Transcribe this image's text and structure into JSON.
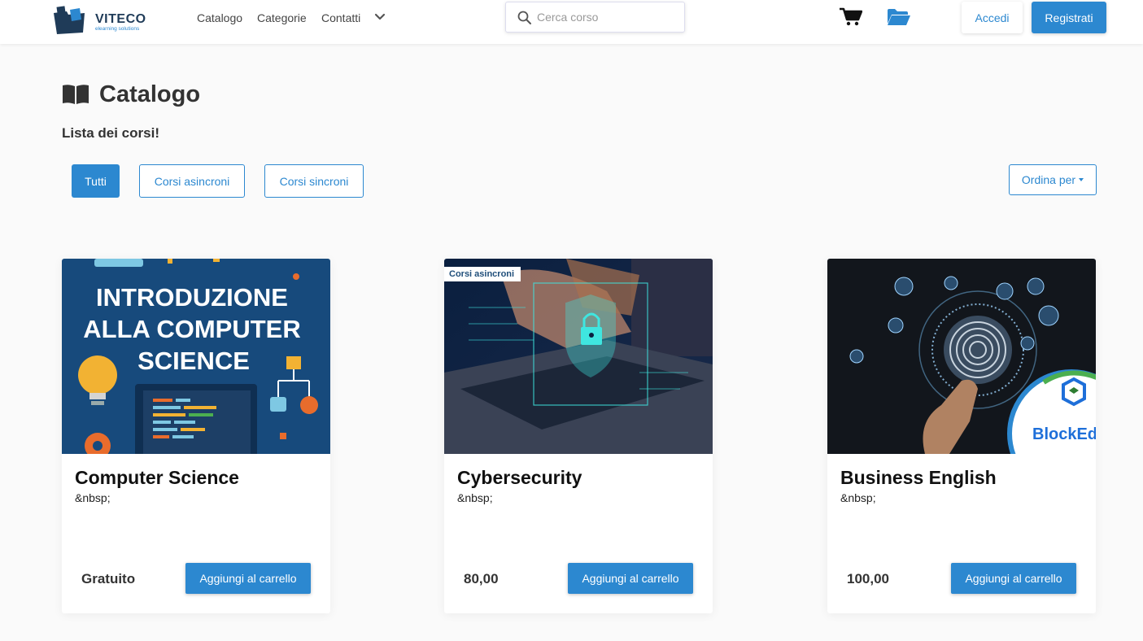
{
  "brand": {
    "name": "VITECO",
    "tagline": "elearning solutions"
  },
  "nav": {
    "items": [
      "Catalogo",
      "Categorie",
      "Contatti"
    ]
  },
  "search": {
    "placeholder": "Cerca corso"
  },
  "header": {
    "login_label": "Accedi",
    "register_label": "Registrati"
  },
  "page": {
    "title": "Catalogo",
    "subtitle": "Lista dei corsi!"
  },
  "filters": {
    "all": "Tutti",
    "async": "Corsi asincroni",
    "sync": "Corsi sincroni",
    "sort": "Ordina per"
  },
  "courses": [
    {
      "title": "Computer Science",
      "desc": "&nbsp;",
      "price": "Gratuito",
      "add_label": "Aggiungi al carrello",
      "thumb": {
        "line1": "INTRODUZIONE",
        "line2": "ALLA COMPUTER",
        "line3": "SCIENCE"
      }
    },
    {
      "title": "Cybersecurity",
      "desc": "&nbsp;",
      "price": "80,00",
      "add_label": "Aggiungi al carrello",
      "badge": "Corsi asincroni"
    },
    {
      "title": "Business English",
      "desc": "&nbsp;",
      "price": "100,00",
      "add_label": "Aggiungi al carrello",
      "logo_text": "BlockEd"
    }
  ],
  "colors": {
    "accent": "#2c88d0",
    "brand_dark": "#1f3b58"
  },
  "icons": [
    "logo-folder-icon",
    "search-icon",
    "chevron-down-icon",
    "cart-icon",
    "folder-open-icon",
    "book-open-icon"
  ]
}
